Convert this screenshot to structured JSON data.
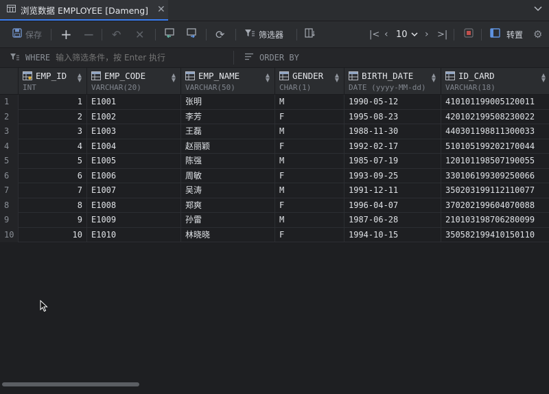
{
  "tab": {
    "title": "浏览数据 EMPLOYEE [Dameng]"
  },
  "toolbar": {
    "save_label": "保存",
    "filter_label": "筛选器",
    "page_size": "10",
    "transpose_label": "转置"
  },
  "filter": {
    "where_keyword": "WHERE",
    "where_placeholder": "输入筛选条件，按 Enter 执行",
    "order_keyword": "ORDER BY"
  },
  "columns": [
    {
      "name": "EMP_ID",
      "type": "INT",
      "icon": "key-column-icon"
    },
    {
      "name": "EMP_CODE",
      "type": "VARCHAR(20)",
      "icon": "table-column-icon"
    },
    {
      "name": "EMP_NAME",
      "type": "VARCHAR(50)",
      "icon": "table-column-icon"
    },
    {
      "name": "GENDER",
      "type": "CHAR(1)",
      "icon": "table-column-icon"
    },
    {
      "name": "BIRTH_DATE",
      "type": "DATE (yyyy-MM-dd)",
      "icon": "table-column-icon"
    },
    {
      "name": "ID_CARD",
      "type": "VARCHAR(18)",
      "icon": "table-column-icon"
    }
  ],
  "rows": [
    {
      "n": "1",
      "id": "1",
      "code": "E1001",
      "name": "张明",
      "gender": "M",
      "birth": "1990-05-12",
      "card": "410101199005120011"
    },
    {
      "n": "2",
      "id": "2",
      "code": "E1002",
      "name": "李芳",
      "gender": "F",
      "birth": "1995-08-23",
      "card": "420102199508230022"
    },
    {
      "n": "3",
      "id": "3",
      "code": "E1003",
      "name": "王磊",
      "gender": "M",
      "birth": "1988-11-30",
      "card": "440301198811300033"
    },
    {
      "n": "4",
      "id": "4",
      "code": "E1004",
      "name": "赵丽颖",
      "gender": "F",
      "birth": "1992-02-17",
      "card": "510105199202170044"
    },
    {
      "n": "5",
      "id": "5",
      "code": "E1005",
      "name": "陈强",
      "gender": "M",
      "birth": "1985-07-19",
      "card": "120101198507190055"
    },
    {
      "n": "6",
      "id": "6",
      "code": "E1006",
      "name": "周敏",
      "gender": "F",
      "birth": "1993-09-25",
      "card": "330106199309250066"
    },
    {
      "n": "7",
      "id": "7",
      "code": "E1007",
      "name": "吴涛",
      "gender": "M",
      "birth": "1991-12-11",
      "card": "350203199112110077"
    },
    {
      "n": "8",
      "id": "8",
      "code": "E1008",
      "name": "郑爽",
      "gender": "F",
      "birth": "1996-04-07",
      "card": "370202199604070088"
    },
    {
      "n": "9",
      "id": "9",
      "code": "E1009",
      "name": "孙雷",
      "gender": "M",
      "birth": "1987-06-28",
      "card": "210103198706280099"
    },
    {
      "n": "10",
      "id": "10",
      "code": "E1010",
      "name": "林晓晓",
      "gender": "F",
      "birth": "1994-10-15",
      "card": "350582199410150110"
    }
  ],
  "colors": {
    "accent": "#3c7ef0",
    "background": "#1e1f22",
    "panel": "#2b2d30"
  }
}
